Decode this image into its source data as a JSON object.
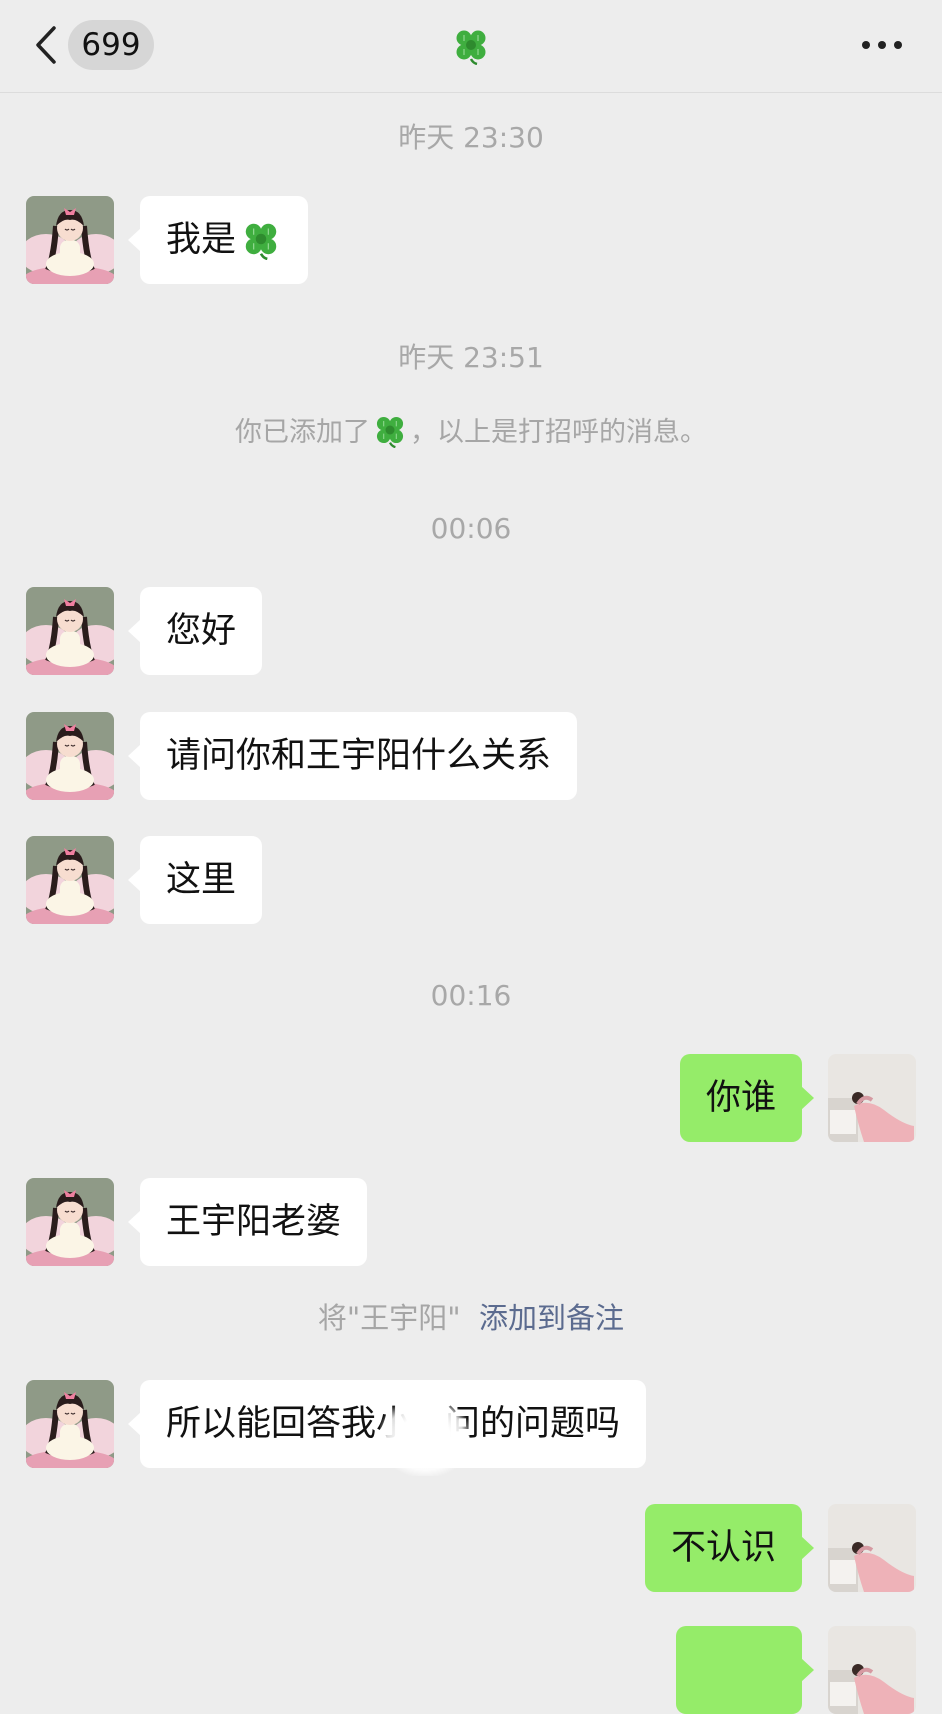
{
  "header": {
    "back_icon": "chevron-left-icon",
    "badge_count": "699",
    "title_icon": "four-leaf-clover-emoji",
    "more_icon": "ellipsis-icon"
  },
  "timestamps": {
    "t1": "昨天 23:30",
    "t2": "昨天 23:51",
    "t3": "00:06",
    "t4": "00:16"
  },
  "messages": {
    "m1": "我是",
    "m2": "您好",
    "m3": "请问你和王宇阳什么关系",
    "m4": "这里",
    "m5": "你谁",
    "m6": "王宇阳老婆",
    "m7_a": "所以能回答我小",
    "m7_b": "问的问题吗",
    "m8": "不认识"
  },
  "system": {
    "added_prefix": "你已添加了",
    "added_suffix": "，以上是打招呼的消息。",
    "remark_prefix": "将\"王宇阳\"",
    "remark_link": "添加到备注"
  },
  "colors": {
    "background": "#ededed",
    "incoming_bubble": "#ffffff",
    "outgoing_bubble": "#95ec69",
    "timestamp_text": "#a8a8a8",
    "link_text": "#5b6b8f"
  }
}
